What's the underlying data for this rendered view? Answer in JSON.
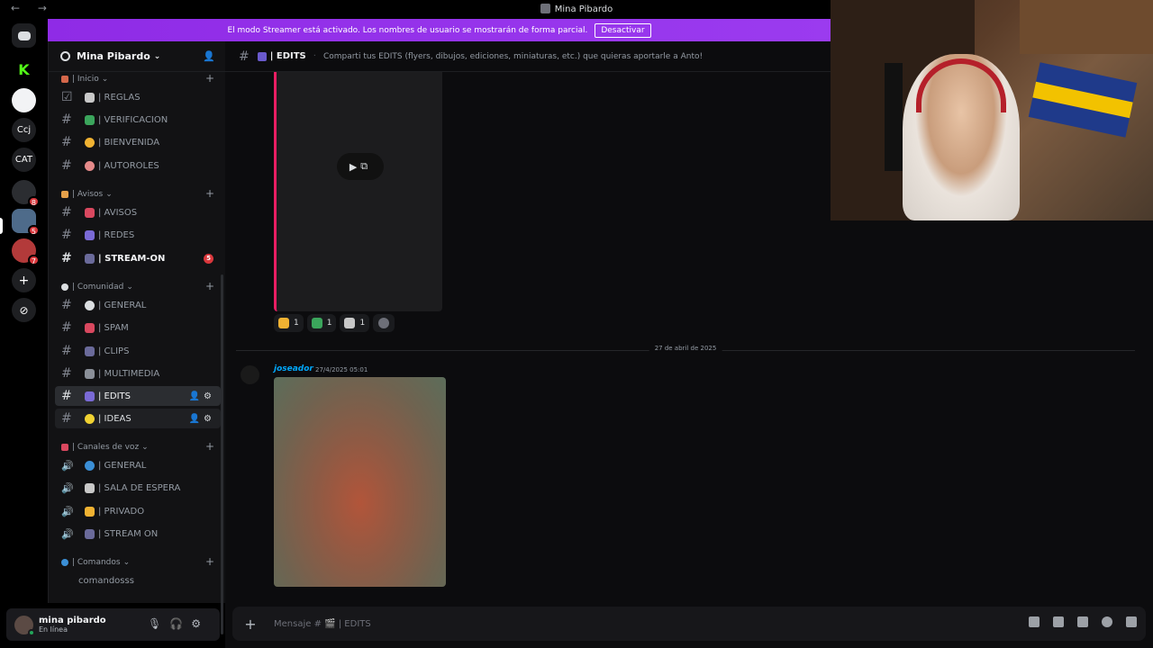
{
  "window": {
    "title": "Mina Pibardo",
    "nav": "← →"
  },
  "rail": {
    "servers": [
      {
        "name": "discord-home",
        "label": "",
        "color": "#1e1f22"
      },
      {
        "name": "kick",
        "label": "K",
        "color": "#000000"
      },
      {
        "name": "server-a",
        "label": "",
        "color": "#f2f3f5"
      },
      {
        "name": "server-ccj",
        "label": "Ccj",
        "color": "#1e1f22"
      },
      {
        "name": "server-cat",
        "label": "CAT",
        "color": "#1e1f22"
      },
      {
        "name": "server-b",
        "label": "",
        "color": "#2b2d31",
        "badge": "8"
      },
      {
        "name": "server-c",
        "label": "",
        "color": "#4e6b8a",
        "badge": "5"
      },
      {
        "name": "server-d",
        "label": "",
        "color": "#b33a3a",
        "badge": "7"
      },
      {
        "name": "add-server",
        "label": "+",
        "color": "#1e1f22"
      },
      {
        "name": "discover",
        "label": "⊘",
        "color": "#1e1f22"
      }
    ]
  },
  "banner": {
    "text": "El modo Streamer está activado. Los nombres de usuario se mostrarán de forma parcial.",
    "button": "Desactivar"
  },
  "sidebar": {
    "server_name": "Mina Pibardo",
    "categories": [
      {
        "label": "| Inicio",
        "channels": [
          "| REGLAS",
          "| VERIFICACION",
          "| BIENVENIDA",
          "| AUTOROLES"
        ]
      },
      {
        "label": "| Avisos",
        "channels": [
          "| AVISOS",
          "| REDES",
          "| STREAM-ON"
        ]
      },
      {
        "label": "| Comunidad",
        "channels": [
          "| GENERAL",
          "| SPAM",
          "| CLIPS",
          "| MULTIMEDIA",
          "| EDITS",
          "| IDEAS"
        ]
      },
      {
        "label": "| Canales de voz",
        "channels": [
          "| GENERAL",
          "| SALA DE ESPERA",
          "| PRIVADO",
          "| STREAM ON"
        ]
      },
      {
        "label": "| Comandos",
        "channels": [
          "comandosss"
        ]
      }
    ],
    "stream_on_badge": "5"
  },
  "user": {
    "name": "mina pibardo",
    "status": "En línea"
  },
  "channel": {
    "name": "| EDITS",
    "topic": "Comparti tus EDITS (flyers, dibujos, ediciones, miniaturas, etc.) que quieras aportarle a Anto!"
  },
  "messages": {
    "reactions": [
      {
        "emoji": "thumbs-up",
        "count": "1",
        "color": "#f0b232"
      },
      {
        "emoji": "check",
        "count": "1",
        "color": "#3ba55c"
      },
      {
        "emoji": "goat",
        "count": "1",
        "color": "#c8c8c8"
      }
    ],
    "date_divider": "27 de abril de 2025",
    "author": "joseador",
    "timestamp": "27/4/2025 05:01"
  },
  "composer": {
    "placeholder": "Mensaje # 🎬 | EDITS"
  }
}
